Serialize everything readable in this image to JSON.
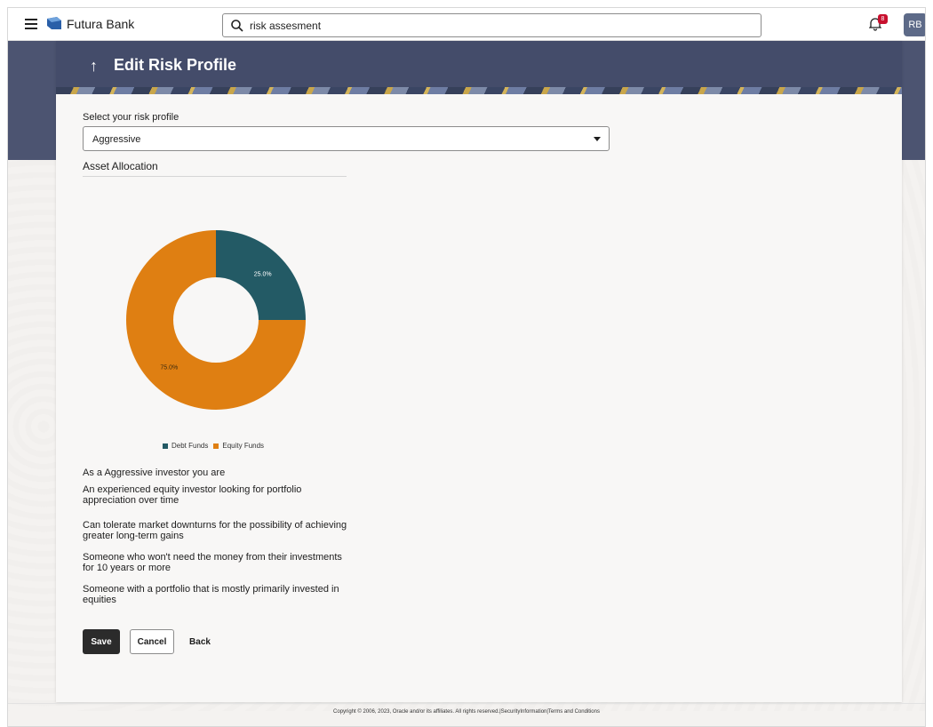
{
  "header": {
    "brand": "Futura Bank",
    "search_value": "risk assesment",
    "notification_count": "8",
    "avatar_initials": "RB"
  },
  "page": {
    "back_arrow": "↑",
    "title": "Edit Risk Profile"
  },
  "form": {
    "risk_label": "Select your risk profile",
    "risk_value": "Aggressive",
    "allocation_title": "Asset Allocation"
  },
  "chart_data": {
    "type": "pie",
    "donut": true,
    "categories": [
      "Debt Funds",
      "Equity Funds"
    ],
    "values": [
      25.0,
      75.0
    ],
    "labels": [
      "25.0%",
      "75.0%"
    ],
    "colors": [
      "#235a65",
      "#df7f12"
    ],
    "legend_position": "bottom"
  },
  "description": {
    "heading": "As a Aggressive investor you are",
    "points": [
      "An experienced equity investor looking for portfolio appreciation over time",
      "Can tolerate market downturns for the possibility of achieving greater long-term gains",
      "Someone who won't need the money from their investments for 10 years or more",
      "Someone with a portfolio that is mostly primarily invested in equities"
    ]
  },
  "actions": {
    "save": "Save",
    "cancel": "Cancel",
    "back": "Back"
  },
  "footer": {
    "text": "Copyright © 2006, 2023, Oracle and/or its affiliates. All rights reserved.|SecurityInformation|Terms and Conditions"
  }
}
